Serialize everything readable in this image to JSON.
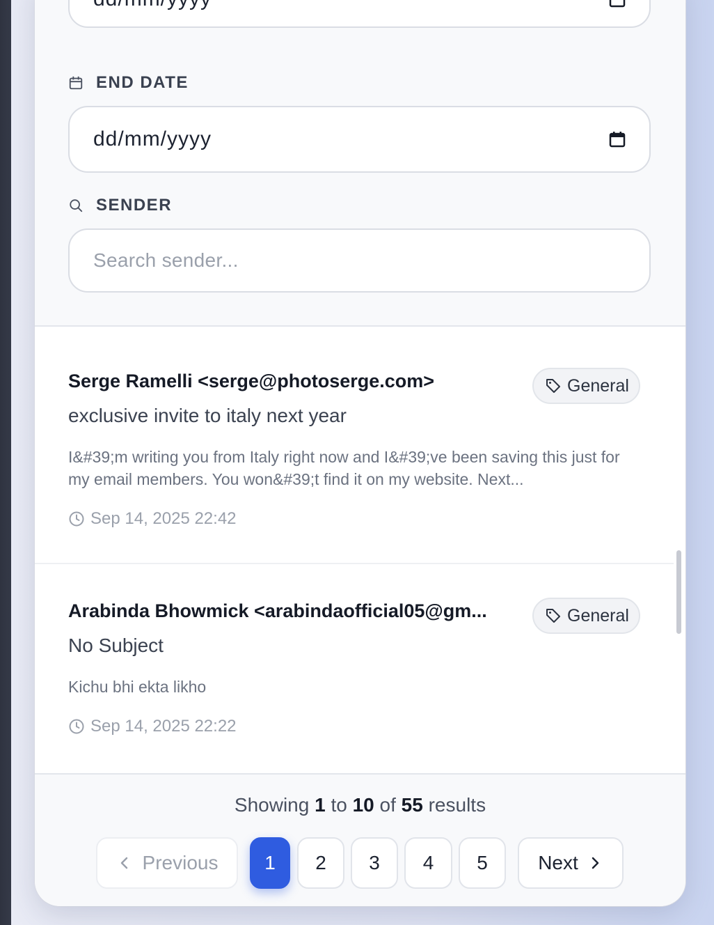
{
  "filters": {
    "start_date": {
      "value": "dd/mm/yyyy"
    },
    "end_date": {
      "label": "END DATE",
      "value": "dd/mm/yyyy"
    },
    "sender": {
      "label": "SENDER",
      "placeholder": "Search sender..."
    }
  },
  "emails": [
    {
      "sender": "Serge Ramelli <serge@photoserge.com>",
      "subject": "exclusive invite to italy next year",
      "snippet": "I&#39;m writing you from Italy right now and I&#39;ve been saving this just for my email members. You won&#39;t find it on my website. Next...",
      "timestamp": "Sep 14, 2025 22:42",
      "tag": "General"
    },
    {
      "sender": "Arabinda Bhowmick <arabindaofficial05@gm...",
      "subject": "No Subject",
      "snippet": "Kichu bhi ekta likho",
      "timestamp": "Sep 14, 2025 22:22",
      "tag": "General"
    }
  ],
  "pagination": {
    "showing_prefix": "Showing",
    "from": "1",
    "to_word": "to",
    "to": "10",
    "of_word": "of",
    "total": "55",
    "results_word": "results",
    "previous_label": "Previous",
    "next_label": "Next",
    "pages": [
      "1",
      "2",
      "3",
      "4",
      "5"
    ],
    "current_page": "1"
  },
  "colors": {
    "accent": "#2f5ce0",
    "background": "#f8f9fb"
  }
}
